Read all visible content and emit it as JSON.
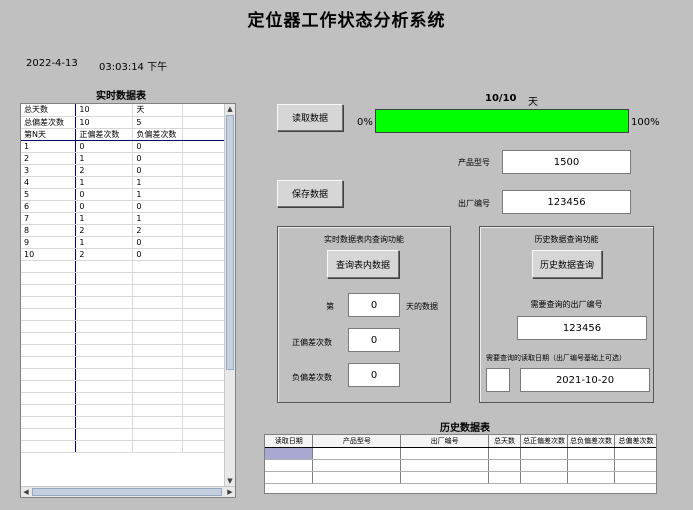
{
  "title": "定位器工作状态分析系统",
  "date": "2022-4-13",
  "time": "03:03:14 下午",
  "realtime_table": {
    "title": "实时数据表",
    "summary": [
      {
        "c0": "总天数",
        "c1": "10",
        "c2": "天"
      },
      {
        "c0": "总偏差次数",
        "c1": "10",
        "c2": "5"
      }
    ],
    "headers": [
      "第N天",
      "正偏差次数",
      "负偏差次数"
    ],
    "rows": [
      [
        "1",
        "0",
        "0"
      ],
      [
        "2",
        "1",
        "0"
      ],
      [
        "3",
        "2",
        "0"
      ],
      [
        "4",
        "1",
        "1"
      ],
      [
        "5",
        "0",
        "1"
      ],
      [
        "6",
        "0",
        "0"
      ],
      [
        "7",
        "1",
        "1"
      ],
      [
        "8",
        "2",
        "2"
      ],
      [
        "9",
        "1",
        "0"
      ],
      [
        "10",
        "2",
        "0"
      ]
    ]
  },
  "buttons": {
    "read": "读取数据",
    "save": "保存数据",
    "query_table": "查询表内数据",
    "query_history": "历史数据查询"
  },
  "progress": {
    "count": "10/10",
    "unit": "天",
    "min_label": "0%",
    "max_label": "100%",
    "fraction": 1.0,
    "color": "#00ff00"
  },
  "product": {
    "model_label": "产品型号",
    "model_value": "1500",
    "serial_label": "出厂编号",
    "serial_value": "123456"
  },
  "realtime_query": {
    "title": "实时数据表内查询功能",
    "day_prefix": "第",
    "day_value": "0",
    "day_suffix": "天的数据",
    "pos_label": "正偏差次数",
    "pos_value": "0",
    "neg_label": "负偏差次数",
    "neg_value": "0"
  },
  "history_query": {
    "title": "历史数据查询功能",
    "serial_prompt": "需要查询的出厂编号",
    "serial_value": "123456",
    "date_prompt": "需要查询的读取日期（出厂编号基础上可选）",
    "date_value": "2021-10-20",
    "checkbox_value": ""
  },
  "history_table": {
    "title": "历史数据表",
    "headers": [
      "读取日期",
      "产品型号",
      "出厂编号",
      "总天数",
      "总正偏差次数",
      "总负偏差次数",
      "总偏差次数"
    ],
    "row_count": 3
  }
}
